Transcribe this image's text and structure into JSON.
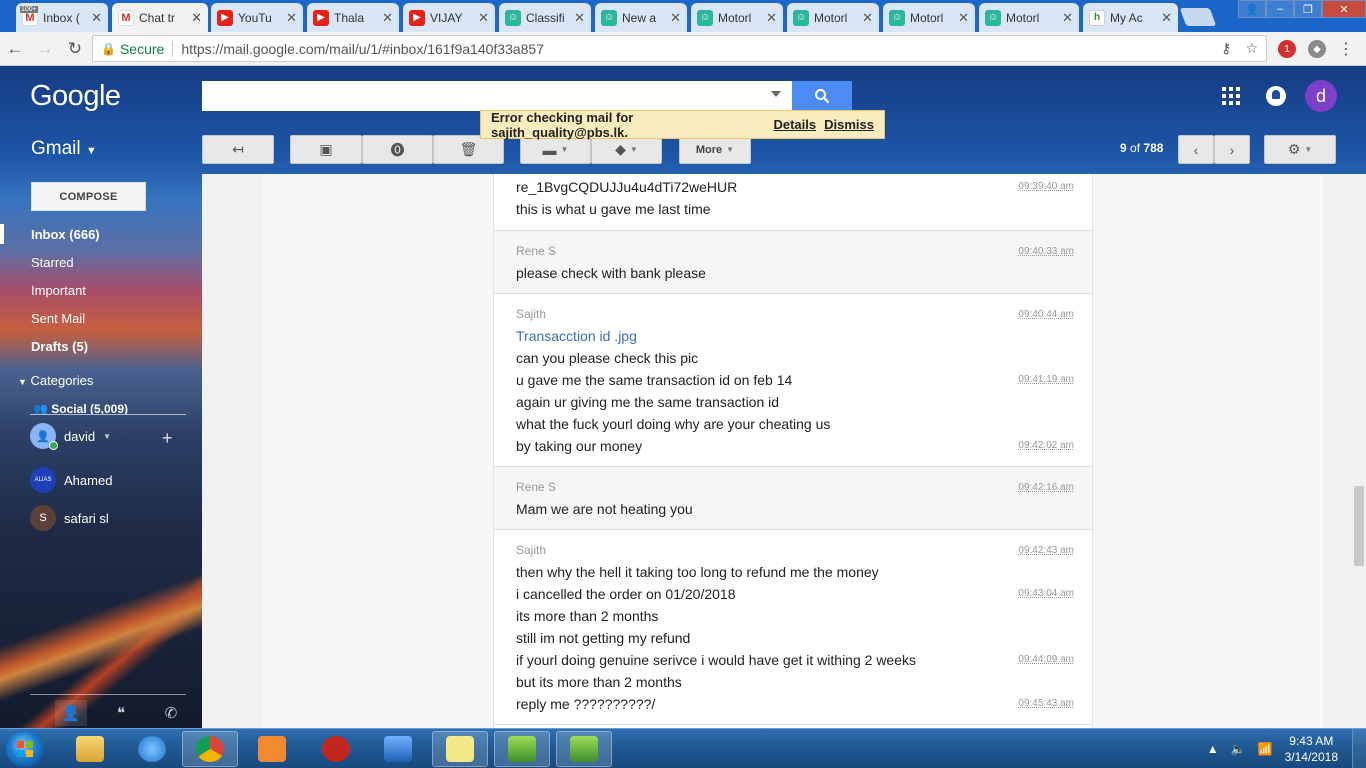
{
  "browser": {
    "tabs": [
      {
        "label": "Inbox (",
        "favicon": "gmail",
        "active": false
      },
      {
        "label": "Chat tr",
        "favicon": "gmail",
        "active": true
      },
      {
        "label": "YouTu",
        "favicon": "youtube",
        "active": false
      },
      {
        "label": "Thala ",
        "favicon": "youtube",
        "active": false
      },
      {
        "label": "VIJAY ",
        "favicon": "youtube",
        "active": false
      },
      {
        "label": "Classifi",
        "favicon": "green",
        "active": false
      },
      {
        "label": "New a",
        "favicon": "green",
        "active": false
      },
      {
        "label": "Motorl",
        "favicon": "green",
        "active": false
      },
      {
        "label": "Motorl",
        "favicon": "green",
        "active": false
      },
      {
        "label": "Motorl",
        "favicon": "green",
        "active": false
      },
      {
        "label": "Motorl",
        "favicon": "green",
        "active": false
      },
      {
        "label": "My Ac",
        "favicon": "account",
        "active": false
      }
    ],
    "badge_text": "100+",
    "secure_label": "Secure",
    "url": "https://mail.google.com/mail/u/1/#inbox/161f9a140f33a857",
    "extension_badge": "1"
  },
  "header": {
    "logo_text": "Google",
    "search_value": "",
    "avatar_letter": "d"
  },
  "error_banner": {
    "message": "Error checking mail for sajith_quality@pbs.lk.",
    "details_label": "Details",
    "dismiss_label": "Dismiss"
  },
  "toolbar": {
    "gmail_label": "Gmail",
    "more_label": "More",
    "page_range": "9",
    "page_of": "of",
    "page_total": "788"
  },
  "sidebar": {
    "compose_label": "COMPOSE",
    "items": [
      {
        "label": "Inbox (666)",
        "bold": true
      },
      {
        "label": "Starred",
        "bold": false
      },
      {
        "label": "Important",
        "bold": false
      },
      {
        "label": "Sent Mail",
        "bold": false
      },
      {
        "label": "Drafts (5)",
        "bold": true
      }
    ],
    "categories_label": "Categories",
    "social_label": "Social (5,009)",
    "chat_user": "david",
    "contacts": [
      {
        "name": "Ahamed",
        "initial": "ALIAS"
      },
      {
        "name": "safari sl",
        "initial": "S"
      }
    ]
  },
  "chat": {
    "blocks": [
      {
        "sender": "",
        "lines": [
          {
            "text": "re_1BvgCQDUJJu4u4dTi72weHUR",
            "time": "09:39:40 am",
            "link": false
          },
          {
            "text": "this is what u gave me last time",
            "time": "",
            "link": false
          }
        ]
      },
      {
        "sender": "Rene S",
        "sender_time": "09:40:33 am",
        "lines": [
          {
            "text": "please check with bank please",
            "time": "",
            "link": false
          }
        ]
      },
      {
        "sender": "Sajith",
        "sender_time": "09:40:44 am",
        "lines": [
          {
            "text": "Transacction id .jpg",
            "time": "",
            "link": true
          },
          {
            "text": "can you please check this pic",
            "time": "",
            "link": false
          },
          {
            "text": "u gave me the same transaction id on feb 14",
            "time": "09:41:19 am",
            "link": false
          },
          {
            "text": "again ur giving me the same transaction id",
            "time": "",
            "link": false
          },
          {
            "text": "what the fuck yourl doing why are your cheating us",
            "time": "",
            "link": false
          },
          {
            "text": "by taking our money",
            "time": "09:42:02 am",
            "link": false
          }
        ]
      },
      {
        "sender": "Rene S",
        "sender_time": "09:42:16 am",
        "lines": [
          {
            "text": "Mam we are not heating you",
            "time": "",
            "link": false
          }
        ]
      },
      {
        "sender": "Sajith",
        "sender_time": "09:42:43 am",
        "lines": [
          {
            "text": "then why the hell it taking too long to refund me the money",
            "time": "",
            "link": false
          },
          {
            "text": "i cancelled the order on 01/20/2018",
            "time": "09:43:04 am",
            "link": false
          },
          {
            "text": "its more than 2 months",
            "time": "",
            "link": false
          },
          {
            "text": "still im not getting my refund",
            "time": "",
            "link": false
          },
          {
            "text": "if yourl doing genuine serivce i would have get it withing 2 weeks",
            "time": "09:44:09 am",
            "link": false
          },
          {
            "text": "but its more than 2 months",
            "time": "",
            "link": false
          },
          {
            "text": "reply me ??????????/",
            "time": "09:45:43 am",
            "link": false
          }
        ]
      }
    ]
  },
  "taskbar": {
    "time": "9:43 AM",
    "date": "3/14/2018"
  }
}
